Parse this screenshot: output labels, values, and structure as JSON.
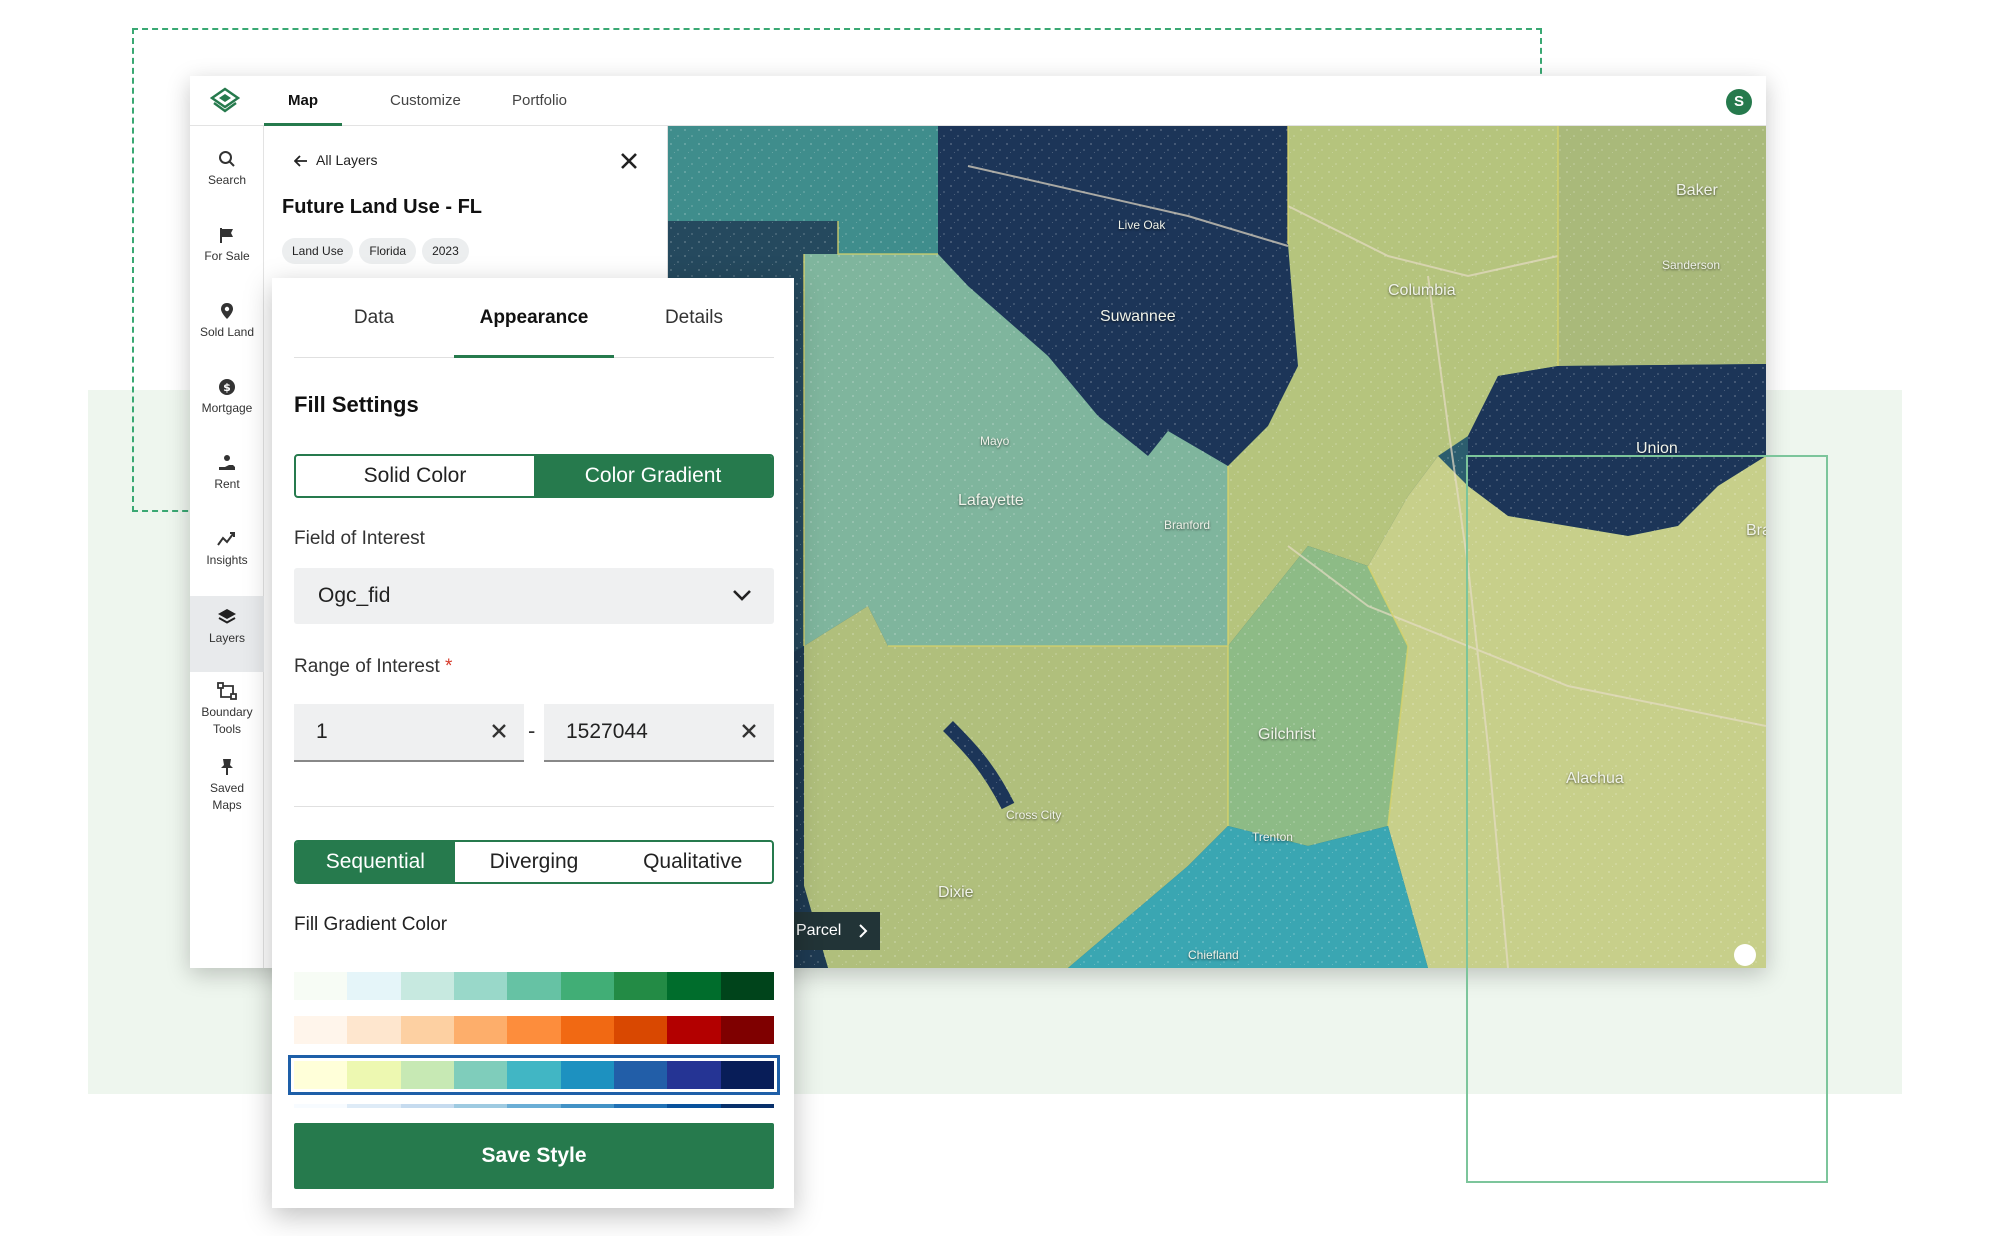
{
  "topbar": {
    "tabs": [
      {
        "label": "Map",
        "active": true
      },
      {
        "label": "Customize",
        "active": false
      },
      {
        "label": "Portfolio",
        "active": false
      }
    ],
    "avatar_initial": "S"
  },
  "sidebar": {
    "items": [
      {
        "label": "Search",
        "icon": "search-icon"
      },
      {
        "label": "For Sale",
        "icon": "flag-icon"
      },
      {
        "label": "Sold Land",
        "icon": "map-pin-icon"
      },
      {
        "label": "Mortgage",
        "icon": "dollar-circle-icon"
      },
      {
        "label": "Rent",
        "icon": "hand-coin-icon"
      },
      {
        "label": "Insights",
        "icon": "trend-icon"
      },
      {
        "label": "Layers",
        "icon": "layers-icon",
        "active": true
      },
      {
        "label": "Boundary Tools",
        "icon": "boundary-icon"
      },
      {
        "label": "Saved Maps",
        "icon": "pin-icon"
      }
    ]
  },
  "layer_panel": {
    "back_label": "All Layers",
    "title": "Future Land Use - FL",
    "chips": [
      "Land Use",
      "Florida",
      "2023"
    ]
  },
  "style_panel": {
    "tabs": [
      {
        "label": "Data",
        "active": false
      },
      {
        "label": "Appearance",
        "active": true
      },
      {
        "label": "Details",
        "active": false
      }
    ],
    "fill_settings_title": "Fill Settings",
    "fill_modes": [
      {
        "label": "Solid Color",
        "active": false
      },
      {
        "label": "Color Gradient",
        "active": true
      }
    ],
    "field_label": "Field of Interest",
    "field_value": "Ogc_fid",
    "range_label": "Range of Interest",
    "range_required": "*",
    "range_min": "1",
    "range_separator": "-",
    "range_max": "1527044",
    "schemes": [
      {
        "label": "Sequential",
        "active": true
      },
      {
        "label": "Diverging",
        "active": false
      },
      {
        "label": "Qualitative",
        "active": false
      }
    ],
    "gradient_label": "Fill Gradient Color",
    "ramps": [
      {
        "name": "greens",
        "selected": false,
        "colors": [
          "#f7fcf5",
          "#e5f5f9",
          "#c7e9e0",
          "#99d8c9",
          "#66c2a4",
          "#41ae76",
          "#238b45",
          "#006d2c",
          "#00441b"
        ]
      },
      {
        "name": "reds",
        "selected": false,
        "colors": [
          "#fff5eb",
          "#fee6ce",
          "#fdd0a2",
          "#fdae6b",
          "#fd8d3c",
          "#f16913",
          "#d94801",
          "#b30000",
          "#7f0000"
        ]
      },
      {
        "name": "ylgnbu",
        "selected": true,
        "colors": [
          "#ffffd9",
          "#edf8b1",
          "#c7e9b4",
          "#7fcdbb",
          "#41b6c4",
          "#1d91c0",
          "#225ea8",
          "#253494",
          "#081d58"
        ]
      },
      {
        "name": "blues",
        "selected": false,
        "colors": [
          "#f7fbff",
          "#deebf7",
          "#c6dbef",
          "#9ecae1",
          "#6baed6",
          "#4292c6",
          "#2171b5",
          "#08519c",
          "#08306b"
        ]
      }
    ],
    "save_label": "Save Style"
  },
  "map": {
    "labels": [
      {
        "text": "Baker",
        "size": "big"
      },
      {
        "text": "Columbia",
        "size": "big"
      },
      {
        "text": "Suwannee",
        "size": "big"
      },
      {
        "text": "Union",
        "size": "big"
      },
      {
        "text": "Lafayette",
        "size": "big"
      },
      {
        "text": "Gilchrist",
        "size": "big"
      },
      {
        "text": "Alachua",
        "size": "big"
      },
      {
        "text": "Dixie",
        "size": "big"
      },
      {
        "text": "Bra",
        "size": "big"
      },
      {
        "text": "Live Oak",
        "size": "small"
      },
      {
        "text": "Mayo",
        "size": "small"
      },
      {
        "text": "Branford",
        "size": "small"
      },
      {
        "text": "Sanderson",
        "size": "small"
      },
      {
        "text": "Cross City",
        "size": "small"
      },
      {
        "text": "Trenton",
        "size": "small"
      },
      {
        "text": "Chiefland",
        "size": "small"
      }
    ],
    "parcel_label": "Parcel",
    "colors": {
      "dark": "#1c3558",
      "teal": "#3f8d8c",
      "mint": "#7fb59d",
      "olive": "#a9b97a",
      "yellow": "#c7cf8a",
      "aqua": "#3aa6b2"
    }
  }
}
